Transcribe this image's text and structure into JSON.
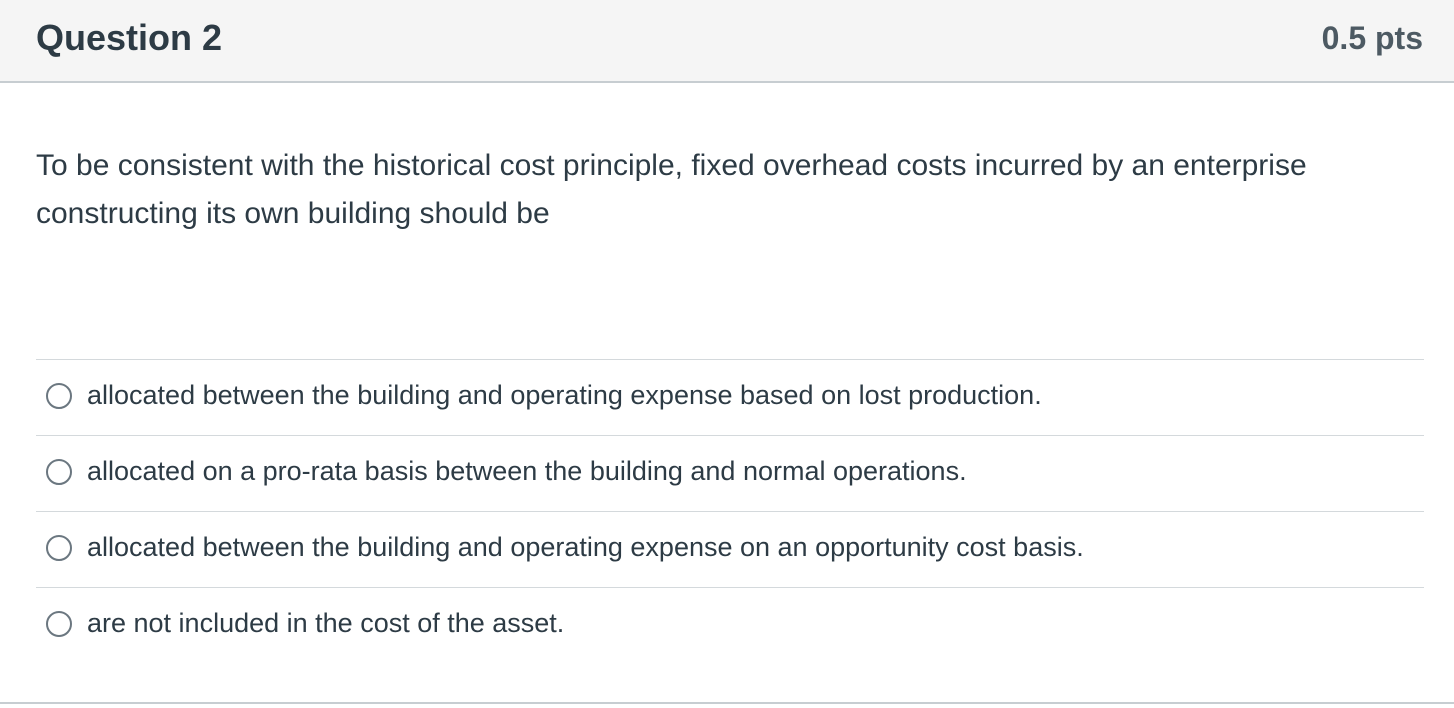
{
  "question": {
    "title": "Question 2",
    "points": "0.5 pts",
    "text": "To be consistent with the historical cost principle, fixed overhead costs incurred by an enterprise constructing its own building should be"
  },
  "answers": [
    {
      "label": "allocated between the building and operating expense based on lost production.",
      "selected": false
    },
    {
      "label": "allocated on a pro-rata basis between the building and normal operations.",
      "selected": false
    },
    {
      "label": "allocated between the building and operating expense on an opportunity cost basis.",
      "selected": false
    },
    {
      "label": "are not included in the cost of the asset.",
      "selected": false
    }
  ],
  "colors": {
    "header_bg": "#f5f5f5",
    "text": "#2d3b45",
    "divider": "#d4d9dc"
  }
}
